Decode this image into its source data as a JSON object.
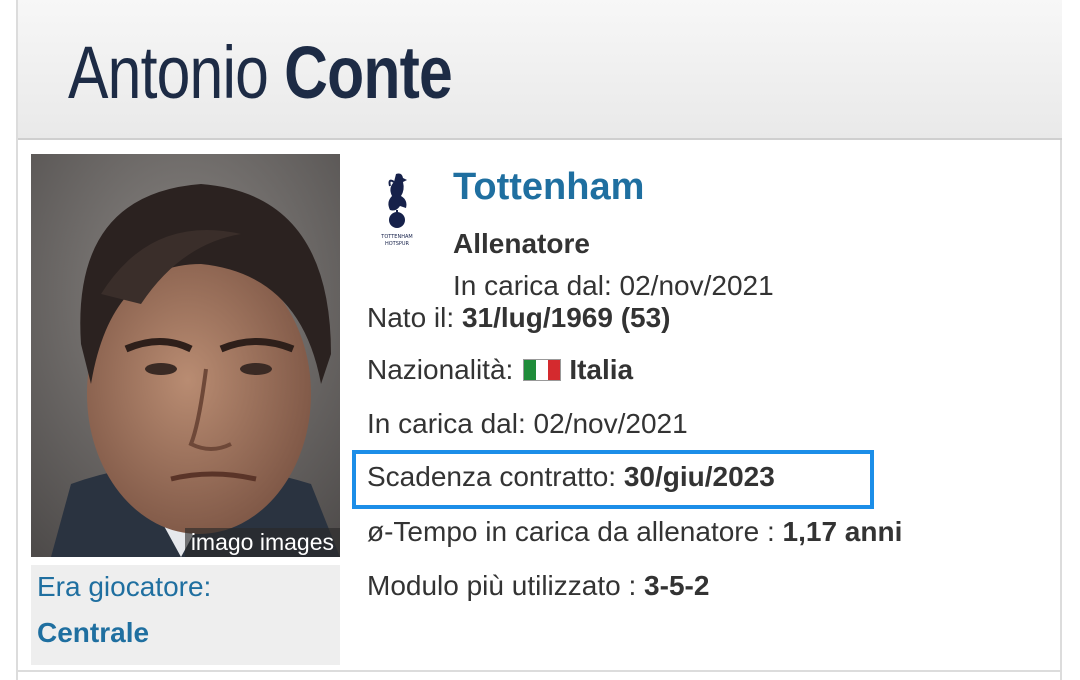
{
  "header": {
    "first_name": "Antonio",
    "last_name": "Conte"
  },
  "photo": {
    "credit": "imago images"
  },
  "player": {
    "era_label": "Era giocatore:",
    "position": "Centrale"
  },
  "club": {
    "name": "Tottenham",
    "crest_icon": "tottenham-cockerel-icon",
    "role": "Allenatore",
    "in_charge_since": "In carica dal: 02/nov/2021"
  },
  "details": {
    "born_label": "Nato il:",
    "born_value": "31/lug/1969 (53)",
    "nationality_label": "Nazionalità:",
    "nationality_value": "Italia",
    "flag_icon": "italy-flag-icon",
    "since_label": "In carica dal:",
    "since_value": "02/nov/2021",
    "contract_label": "Scadenza contratto:",
    "contract_value": "30/giu/2023",
    "tenure_label": "ø-Tempo in carica da allenatore :",
    "tenure_value": "1,17 anni",
    "module_label": "Modulo più utilizzato :",
    "module_value": "3-5-2"
  },
  "colors": {
    "accent_blue": "#1f6fa0",
    "highlight_border": "#1c8ee8",
    "title_navy": "#1d2b45"
  }
}
